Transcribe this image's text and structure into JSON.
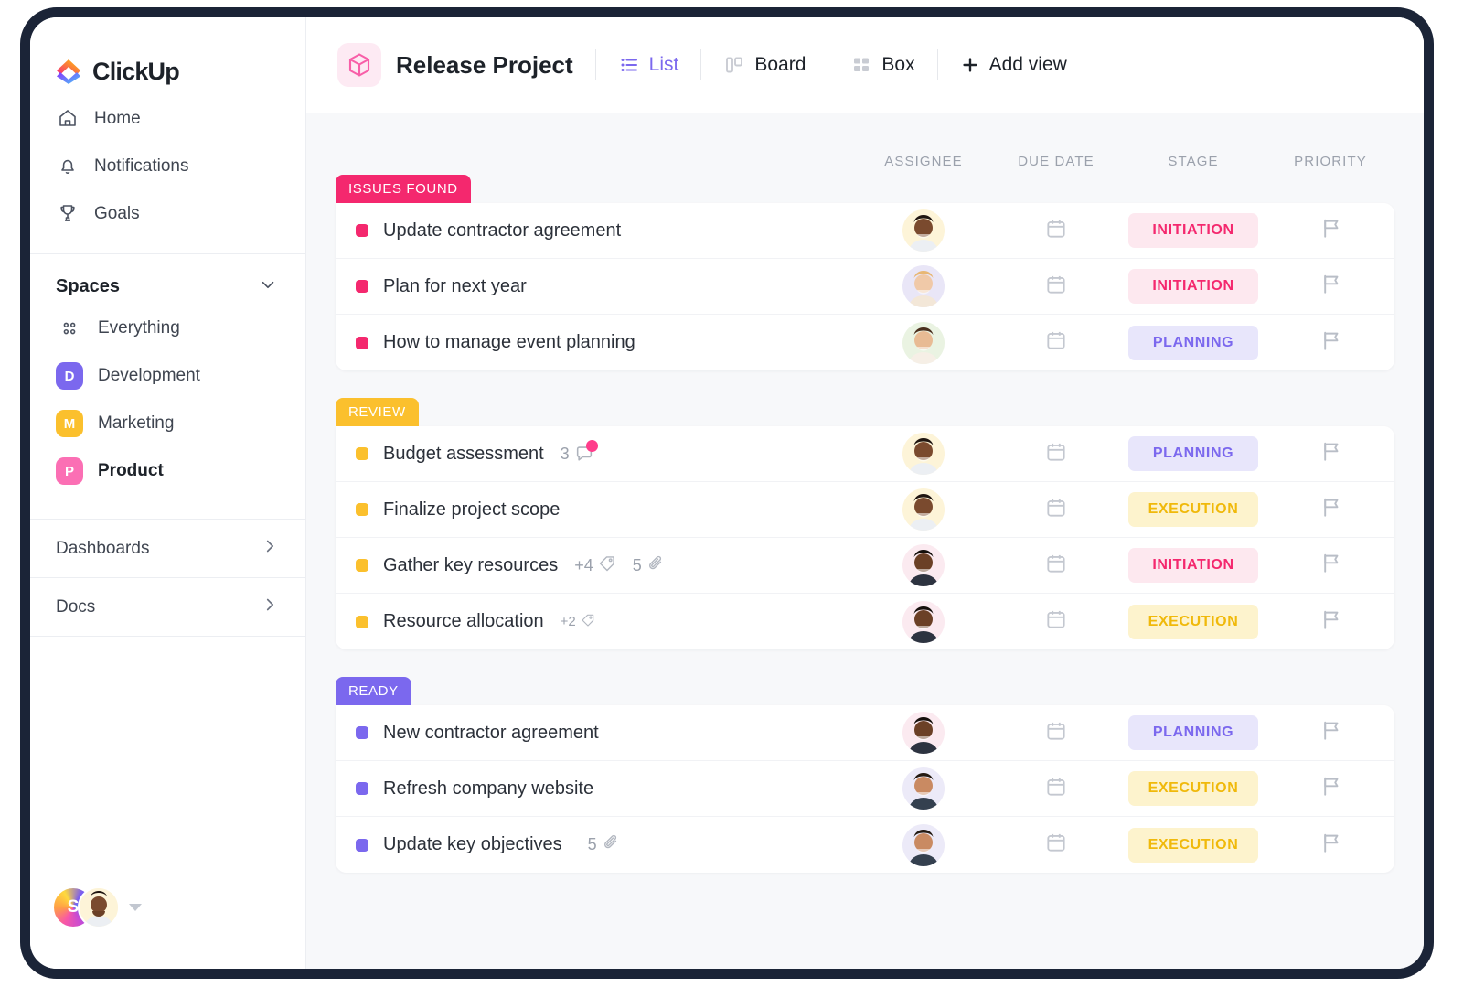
{
  "sidebar": {
    "logo_text": "ClickUp",
    "nav": [
      {
        "label": "Home",
        "icon": "home-icon"
      },
      {
        "label": "Notifications",
        "icon": "bell-icon"
      },
      {
        "label": "Goals",
        "icon": "trophy-icon"
      }
    ],
    "spaces_title": "Spaces",
    "spaces": [
      {
        "label": "Everything",
        "initial": "",
        "color": "",
        "icon": "grid-dots-icon",
        "active": false
      },
      {
        "label": "Development",
        "initial": "D",
        "color": "#7b68ee",
        "active": false
      },
      {
        "label": "Marketing",
        "initial": "M",
        "color": "#fbc02d",
        "active": false
      },
      {
        "label": "Product",
        "initial": "P",
        "color": "#fb6fb4",
        "active": true
      }
    ],
    "footer_links": [
      {
        "label": "Dashboards"
      },
      {
        "label": "Docs"
      }
    ],
    "user": {
      "initial": "S"
    }
  },
  "topbar": {
    "project_title": "Release Project",
    "project_icon": "cube-icon",
    "views": [
      {
        "label": "List",
        "icon": "list-icon",
        "active": true
      },
      {
        "label": "Board",
        "icon": "board-icon",
        "active": false
      },
      {
        "label": "Box",
        "icon": "box-icon",
        "active": false
      }
    ],
    "add_view_label": "Add view",
    "add_view_icon": "plus-icon"
  },
  "columns": {
    "assignee": "ASSIGNEE",
    "due_date": "DUE DATE",
    "stage": "STAGE",
    "priority": "PRIORITY"
  },
  "colors": {
    "issues_found": "#f4286e",
    "review": "#fbc02d",
    "ready": "#7b68ee",
    "initiation_bg": "#fde8ef",
    "initiation_fg": "#f4286e",
    "planning_bg": "#e8e6fb",
    "planning_fg": "#7b68ee",
    "execution_bg": "#fdf3cd",
    "execution_fg": "#f0b90b"
  },
  "groups": [
    {
      "name": "ISSUES FOUND",
      "color": "#f4286e",
      "dot_color": "#f4286e",
      "tasks": [
        {
          "name": "Update contractor agreement",
          "comments": "",
          "tags": "",
          "attachments": "",
          "avatar_bg": "#fdf4d8",
          "avatar_skin": "#7a4a2e",
          "avatar_hair": "#1f1510",
          "avatar_shirt": "#eceff3",
          "stage": "INITIATION",
          "stage_bg": "#fde8ef",
          "stage_fg": "#f4286e",
          "due_icon": "calendar-icon",
          "priority_icon": "flag-icon"
        },
        {
          "name": "Plan for next year",
          "comments": "",
          "tags": "",
          "attachments": "",
          "avatar_bg": "#e9e6f7",
          "avatar_skin": "#f0c9a8",
          "avatar_hair": "#e8b774",
          "avatar_shirt": "#f3e7d8",
          "stage": "INITIATION",
          "stage_bg": "#fde8ef",
          "stage_fg": "#f4286e",
          "due_icon": "calendar-icon",
          "priority_icon": "flag-icon"
        },
        {
          "name": "How to manage event planning",
          "comments": "",
          "tags": "",
          "attachments": "",
          "avatar_bg": "#eaf3e2",
          "avatar_skin": "#e8bb94",
          "avatar_hair": "#4a2f1e",
          "avatar_shirt": "#f6efe6",
          "stage": "PLANNING",
          "stage_bg": "#e8e6fb",
          "stage_fg": "#7b68ee",
          "due_icon": "calendar-icon",
          "priority_icon": "flag-icon"
        }
      ]
    },
    {
      "name": "REVIEW",
      "color": "#fbc02d",
      "dot_color": "#fbc02d",
      "tasks": [
        {
          "name": "Budget assessment",
          "comments": "3",
          "tags": "",
          "attachments": "",
          "avatar_bg": "#fdf4d8",
          "avatar_skin": "#7a4a2e",
          "avatar_hair": "#1f1510",
          "avatar_shirt": "#eceff3",
          "stage": "PLANNING",
          "stage_bg": "#e8e6fb",
          "stage_fg": "#7b68ee",
          "due_icon": "calendar-icon",
          "priority_icon": "flag-icon"
        },
        {
          "name": "Finalize project scope",
          "comments": "",
          "tags": "",
          "attachments": "",
          "avatar_bg": "#fdf4d8",
          "avatar_skin": "#7a4a2e",
          "avatar_hair": "#1f1510",
          "avatar_shirt": "#eceff3",
          "stage": "EXECUTION",
          "stage_bg": "#fdf3cd",
          "stage_fg": "#f0b90b",
          "due_icon": "calendar-icon",
          "priority_icon": "flag-icon"
        },
        {
          "name": "Gather key resources",
          "comments": "",
          "tags": "+4",
          "attachments": "5",
          "avatar_bg": "#fbeaf0",
          "avatar_skin": "#6b4026",
          "avatar_hair": "#15100c",
          "avatar_shirt": "#2d3340",
          "stage": "INITIATION",
          "stage_bg": "#fde8ef",
          "stage_fg": "#f4286e",
          "due_icon": "calendar-icon",
          "priority_icon": "flag-icon"
        },
        {
          "name": "Resource allocation",
          "comments": "",
          "tags": "+2",
          "attachments": "",
          "avatar_bg": "#fbeaf0",
          "avatar_skin": "#6b4026",
          "avatar_hair": "#15100c",
          "avatar_shirt": "#2d3340",
          "stage": "EXECUTION",
          "stage_bg": "#fdf3cd",
          "stage_fg": "#f0b90b",
          "due_icon": "calendar-icon",
          "priority_icon": "flag-icon"
        }
      ]
    },
    {
      "name": "READY",
      "color": "#7b68ee",
      "dot_color": "#7b68ee",
      "tasks": [
        {
          "name": "New contractor agreement",
          "comments": "",
          "tags": "",
          "attachments": "",
          "avatar_bg": "#fbeaf0",
          "avatar_skin": "#6b4026",
          "avatar_hair": "#15100c",
          "avatar_shirt": "#2d3340",
          "stage": "PLANNING",
          "stage_bg": "#e8e6fb",
          "stage_fg": "#7b68ee",
          "due_icon": "calendar-icon",
          "priority_icon": "flag-icon"
        },
        {
          "name": "Refresh company website",
          "comments": "",
          "tags": "",
          "attachments": "",
          "avatar_bg": "#eceaf8",
          "avatar_skin": "#c98a62",
          "avatar_hair": "#241a12",
          "avatar_shirt": "#34404f",
          "stage": "EXECUTION",
          "stage_bg": "#fdf3cd",
          "stage_fg": "#f0b90b",
          "due_icon": "calendar-icon",
          "priority_icon": "flag-icon"
        },
        {
          "name": "Update key objectives",
          "comments": "",
          "tags": "",
          "attachments": "5",
          "avatar_bg": "#eceaf8",
          "avatar_skin": "#c98a62",
          "avatar_hair": "#241a12",
          "avatar_shirt": "#34404f",
          "stage": "EXECUTION",
          "stage_bg": "#fdf3cd",
          "stage_fg": "#f0b90b",
          "due_icon": "calendar-icon",
          "priority_icon": "flag-icon"
        }
      ]
    }
  ]
}
